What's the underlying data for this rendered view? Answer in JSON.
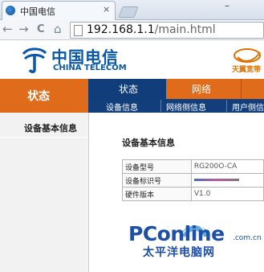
{
  "browser": {
    "tab_title": "中国电信",
    "tab_close": "×",
    "back_glyph": "←",
    "forward_glyph": "→",
    "reload_glyph": "C",
    "home_glyph": "⌂",
    "url_host": "192.168.1.1",
    "url_path": "/main.html",
    "minimize_glyph": "–"
  },
  "header": {
    "brand_cn": "中国电信",
    "brand_en": "CHINA TELECOM",
    "tianyi_text": "天翼宽带"
  },
  "nav": {
    "section_label": "状态",
    "tabs": [
      {
        "label": "状态",
        "active": true
      },
      {
        "label": "网络",
        "active": false
      }
    ],
    "subnav": [
      "设备信息",
      "网络侧信息",
      "用户侧信"
    ]
  },
  "sidebar": {
    "items": [
      {
        "label": "设备基本信息",
        "active": true
      }
    ]
  },
  "content": {
    "title": "设备基本信息",
    "rows": [
      {
        "key": "设备型号",
        "value": "RG200O-CA"
      },
      {
        "key": "设备标识号",
        "value": ""
      },
      {
        "key": "硬件版本",
        "value": "V1.0"
      }
    ]
  },
  "watermark": {
    "brand": "PConline",
    "suffix": ".com.cn",
    "cn": "太平洋电脑网"
  },
  "colors": {
    "orange": "#e06b1b",
    "navy": "#123f7c",
    "telecom_blue": "#0a58a8"
  }
}
